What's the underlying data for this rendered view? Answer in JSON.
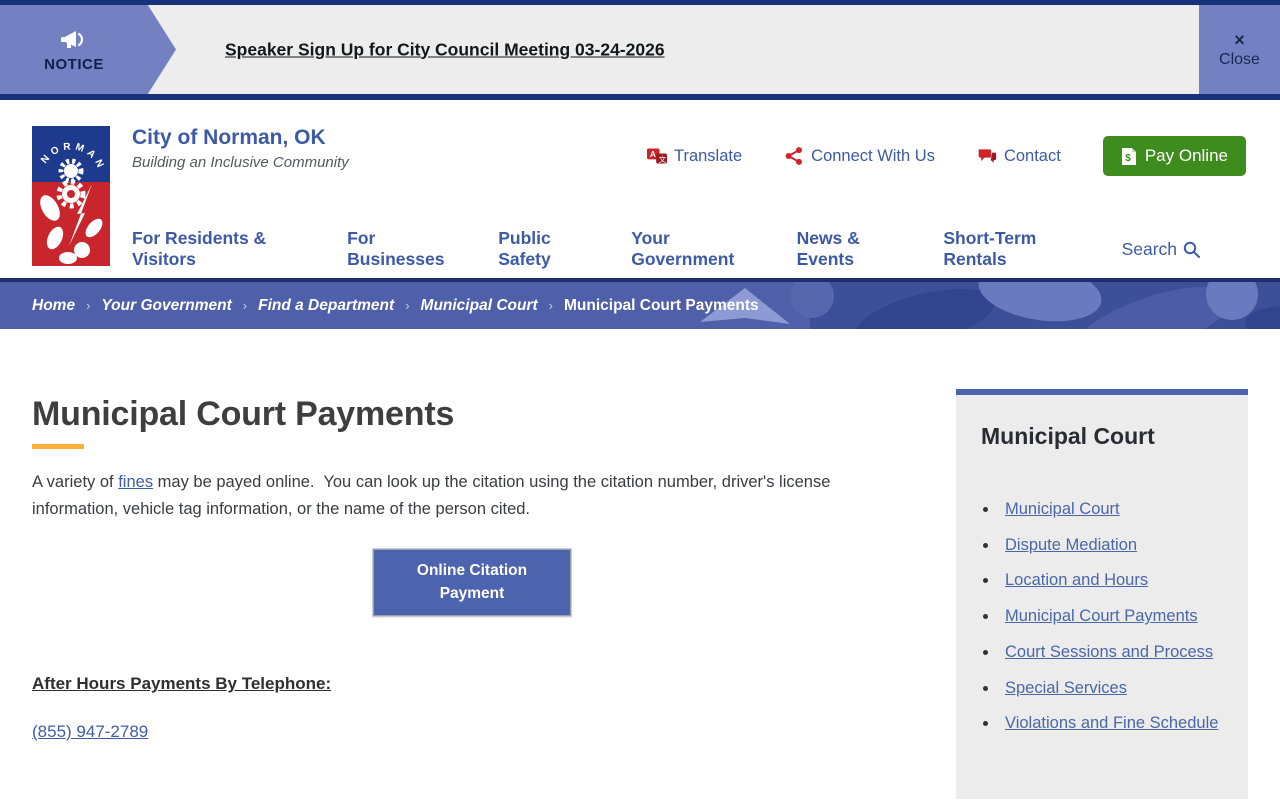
{
  "notice": {
    "label": "NOTICE",
    "link": "Speaker Sign Up for City Council Meeting 03-24-2026",
    "close_x": "×",
    "close_label": "Close"
  },
  "header": {
    "site_title": "City of Norman, OK",
    "tagline": "Building an Inclusive Community",
    "utility": [
      "Translate",
      "Connect With Us",
      "Contact"
    ],
    "pay_online": "Pay Online",
    "search_label": "Search"
  },
  "nav": {
    "items": [
      "For Residents & Visitors",
      "For Businesses",
      "Public Safety",
      "Your Government",
      "News & Events",
      "Short-Term Rentals"
    ]
  },
  "breadcrumb": {
    "items": [
      "Home",
      "Your Government",
      "Find a Department",
      "Municipal Court"
    ],
    "current": "Municipal Court Payments",
    "separator": "›"
  },
  "main": {
    "title": "Municipal Court Payments",
    "intro_before": "A variety of ",
    "intro_link": "fines",
    "intro_after": " may be payed online.  You can look up the citation using the citation number, driver's license information, vehicle tag information, or the name of the person cited.",
    "button_label": "Online Citation Payment",
    "after_hours_heading": "After Hours Payments By Telephone:",
    "phone": "(855) 947-2789"
  },
  "sidebar": {
    "title": "Municipal Court",
    "links": [
      "Municipal Court",
      "Dispute Mediation",
      "Location and Hours",
      "Municipal Court Payments",
      "Court Sessions and Process",
      "Special Services",
      "Violations and Fine Schedule"
    ]
  },
  "colors": {
    "navy": "#16337a",
    "notice_purple": "#7381c3",
    "bar_gray": "#ededed",
    "brand_blue": "#3c5aa6",
    "breadcrumb_bg": "#4f5fa9",
    "breadcrumb_border": "#1d2f6e",
    "link_blue": "#3e5ca8",
    "button_blue": "#4c63ad",
    "sidebar_accent": "#4c63ad",
    "sidebar_bg": "#ececec",
    "sidebar_link": "#4a67a8",
    "green": "#3e8b1e",
    "red": "#cc2429",
    "yellow": "#fbaf3c",
    "heading_gray": "#3e3e3e",
    "logo_blue": "#1e3a8c",
    "logo_red": "#c9252c"
  }
}
